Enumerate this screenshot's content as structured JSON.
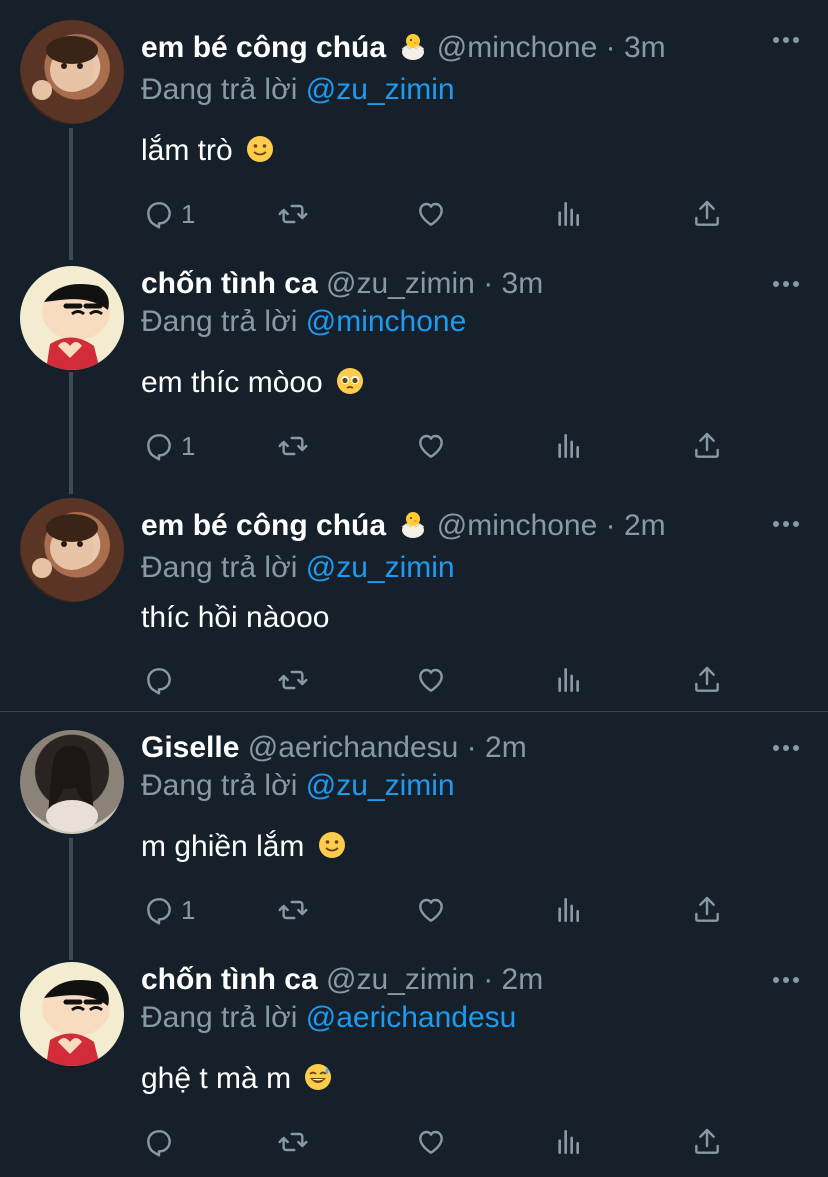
{
  "reply_prefix": "Đang trả lời",
  "tweets": [
    {
      "name": "em bé công chúa",
      "handle": "@minchone",
      "time": "3m",
      "reply_to": "@zu_zimin",
      "text": "lắm trò",
      "text_emoji": "slightly-smiling-face",
      "name_emoji": "hatching-chick",
      "reply_count": "1",
      "avatar": "baby"
    },
    {
      "name": "chốn tình ca",
      "handle": "@zu_zimin",
      "time": "3m",
      "reply_to": "@minchone",
      "text": "em thíc mòoo",
      "text_emoji": "pleading-face",
      "reply_count": "1",
      "avatar": "shinchan"
    },
    {
      "name": "em bé công chúa",
      "handle": "@minchone",
      "time": "2m",
      "reply_to": "@zu_zimin",
      "text": "thíc hồi nàooo",
      "name_emoji": "hatching-chick",
      "reply_count": "",
      "avatar": "baby"
    },
    {
      "name": "Giselle",
      "handle": "@aerichandesu",
      "time": "2m",
      "reply_to": "@zu_zimin",
      "text": "m ghiền lắm",
      "text_emoji": "slightly-smiling-face",
      "reply_count": "1",
      "avatar": "giselle"
    },
    {
      "name": "chốn tình ca",
      "handle": "@zu_zimin",
      "time": "2m",
      "reply_to": "@aerichandesu",
      "text": "ghệ t mà m",
      "text_emoji": "grinning-sweat-face",
      "reply_count": "",
      "avatar": "shinchan"
    }
  ],
  "sep": " · ",
  "colors": {
    "background": "#15202b",
    "accent": "#1d9bf0",
    "secondary_text": "#8899a6",
    "thread_line": "#3d4a57"
  }
}
